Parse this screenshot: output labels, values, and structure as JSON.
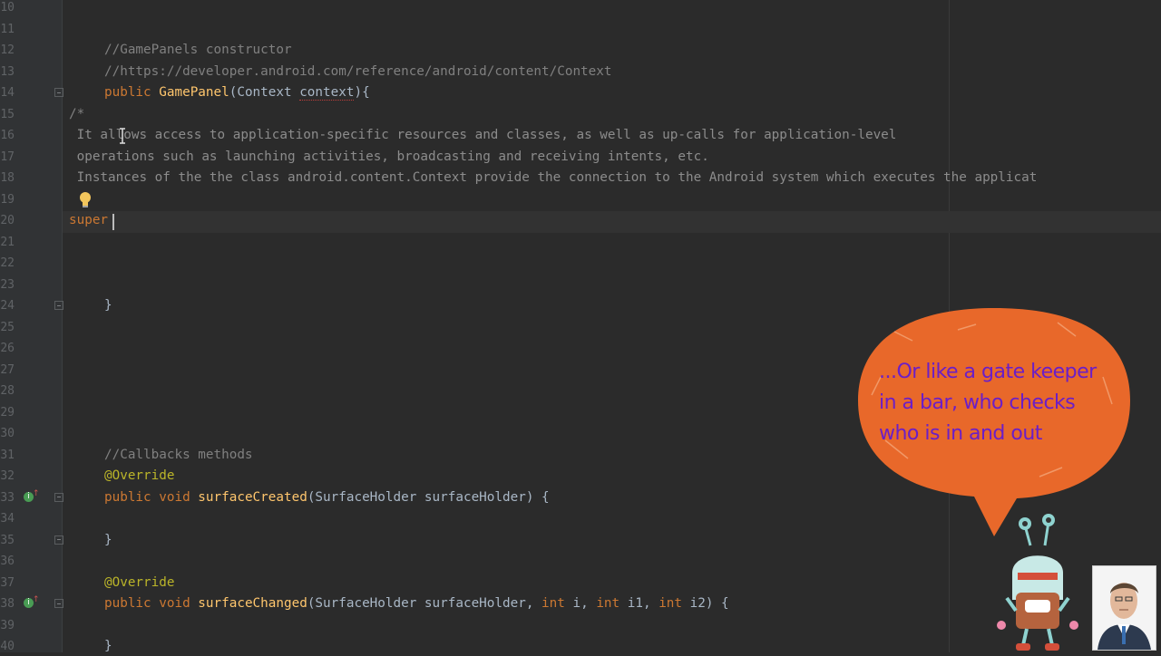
{
  "editor": {
    "lines": [
      {
        "num": "10",
        "tokens": []
      },
      {
        "num": "11",
        "tokens": []
      },
      {
        "num": "12",
        "tokens": [
          {
            "cls": "cmt",
            "text": "//GamePanels constructor"
          }
        ]
      },
      {
        "num": "13",
        "tokens": [
          {
            "cls": "cmt",
            "text": "//https://developer.android.com/reference/android/content/Context"
          }
        ]
      },
      {
        "num": "14",
        "tokens": [
          {
            "cls": "kw",
            "text": "public "
          },
          {
            "cls": "fn",
            "text": "GamePanel"
          },
          {
            "cls": "",
            "text": "(Context "
          },
          {
            "cls": "typo",
            "text": "context"
          },
          {
            "cls": "",
            "text": "){"
          }
        ]
      },
      {
        "num": "15",
        "tokens": [
          {
            "cls": "cmt",
            "text": "/*"
          }
        ]
      },
      {
        "num": "16",
        "tokens": [
          {
            "cls": "cmt-doc",
            "text": " It allows access to application-specific resources and classes, as well as up-calls for application-level"
          }
        ]
      },
      {
        "num": "17",
        "tokens": [
          {
            "cls": "cmt-doc",
            "text": " operations such as launching activities, broadcasting and receiving intents, etc."
          }
        ]
      },
      {
        "num": "18",
        "tokens": [
          {
            "cls": "cmt-doc",
            "text": " Instances of the the class android.content.Context provide the connection to the Android system which executes the applicat"
          }
        ]
      },
      {
        "num": "19",
        "tokens": []
      },
      {
        "num": "20",
        "tokens": [
          {
            "cls": "err",
            "text": "super"
          }
        ]
      },
      {
        "num": "21",
        "tokens": []
      },
      {
        "num": "22",
        "tokens": []
      },
      {
        "num": "23",
        "tokens": []
      },
      {
        "num": "24",
        "tokens": [
          {
            "cls": "",
            "text": "}"
          }
        ]
      },
      {
        "num": "25",
        "tokens": []
      },
      {
        "num": "26",
        "tokens": []
      },
      {
        "num": "27",
        "tokens": []
      },
      {
        "num": "28",
        "tokens": []
      },
      {
        "num": "29",
        "tokens": []
      },
      {
        "num": "30",
        "tokens": []
      },
      {
        "num": "31",
        "tokens": [
          {
            "cls": "cmt",
            "text": "//Callbacks methods"
          }
        ]
      },
      {
        "num": "32",
        "tokens": [
          {
            "cls": "ann",
            "text": "@Override"
          }
        ]
      },
      {
        "num": "33",
        "tokens": [
          {
            "cls": "kw",
            "text": "public void "
          },
          {
            "cls": "fn",
            "text": "surfaceCreated"
          },
          {
            "cls": "",
            "text": "(SurfaceHolder surfaceHolder) {"
          }
        ]
      },
      {
        "num": "34",
        "tokens": []
      },
      {
        "num": "35",
        "tokens": [
          {
            "cls": "",
            "text": "}"
          }
        ]
      },
      {
        "num": "36",
        "tokens": []
      },
      {
        "num": "37",
        "tokens": [
          {
            "cls": "ann",
            "text": "@Override"
          }
        ]
      },
      {
        "num": "38",
        "tokens": [
          {
            "cls": "kw",
            "text": "public void "
          },
          {
            "cls": "fn",
            "text": "surfaceChanged"
          },
          {
            "cls": "",
            "text": "(SurfaceHolder surfaceHolder, "
          },
          {
            "cls": "kw",
            "text": "int "
          },
          {
            "cls": "",
            "text": "i, "
          },
          {
            "cls": "kw",
            "text": "int "
          },
          {
            "cls": "",
            "text": "i1, "
          },
          {
            "cls": "kw",
            "text": "int "
          },
          {
            "cls": "",
            "text": "i2) {"
          }
        ]
      },
      {
        "num": "39",
        "tokens": []
      },
      {
        "num": "40",
        "tokens": [
          {
            "cls": "",
            "text": "}"
          }
        ]
      }
    ]
  },
  "overlay": {
    "bubble_text_line1": "...Or like a gate keeper",
    "bubble_text_line2": "in a bar, who checks",
    "bubble_text_line3": "who is in and out",
    "bubble_color": "#e8682a",
    "bubble_text_color": "#6b1ec7",
    "mascot_icon": "robot-mascot-icon",
    "presenter_icon": "presenter-avatar"
  },
  "colors": {
    "background": "#2b2b2b",
    "gutter": "#313335",
    "keyword": "#cc7832",
    "function": "#ffc66d",
    "comment": "#808080",
    "annotation": "#bbb529",
    "text": "#a9b7c6"
  }
}
